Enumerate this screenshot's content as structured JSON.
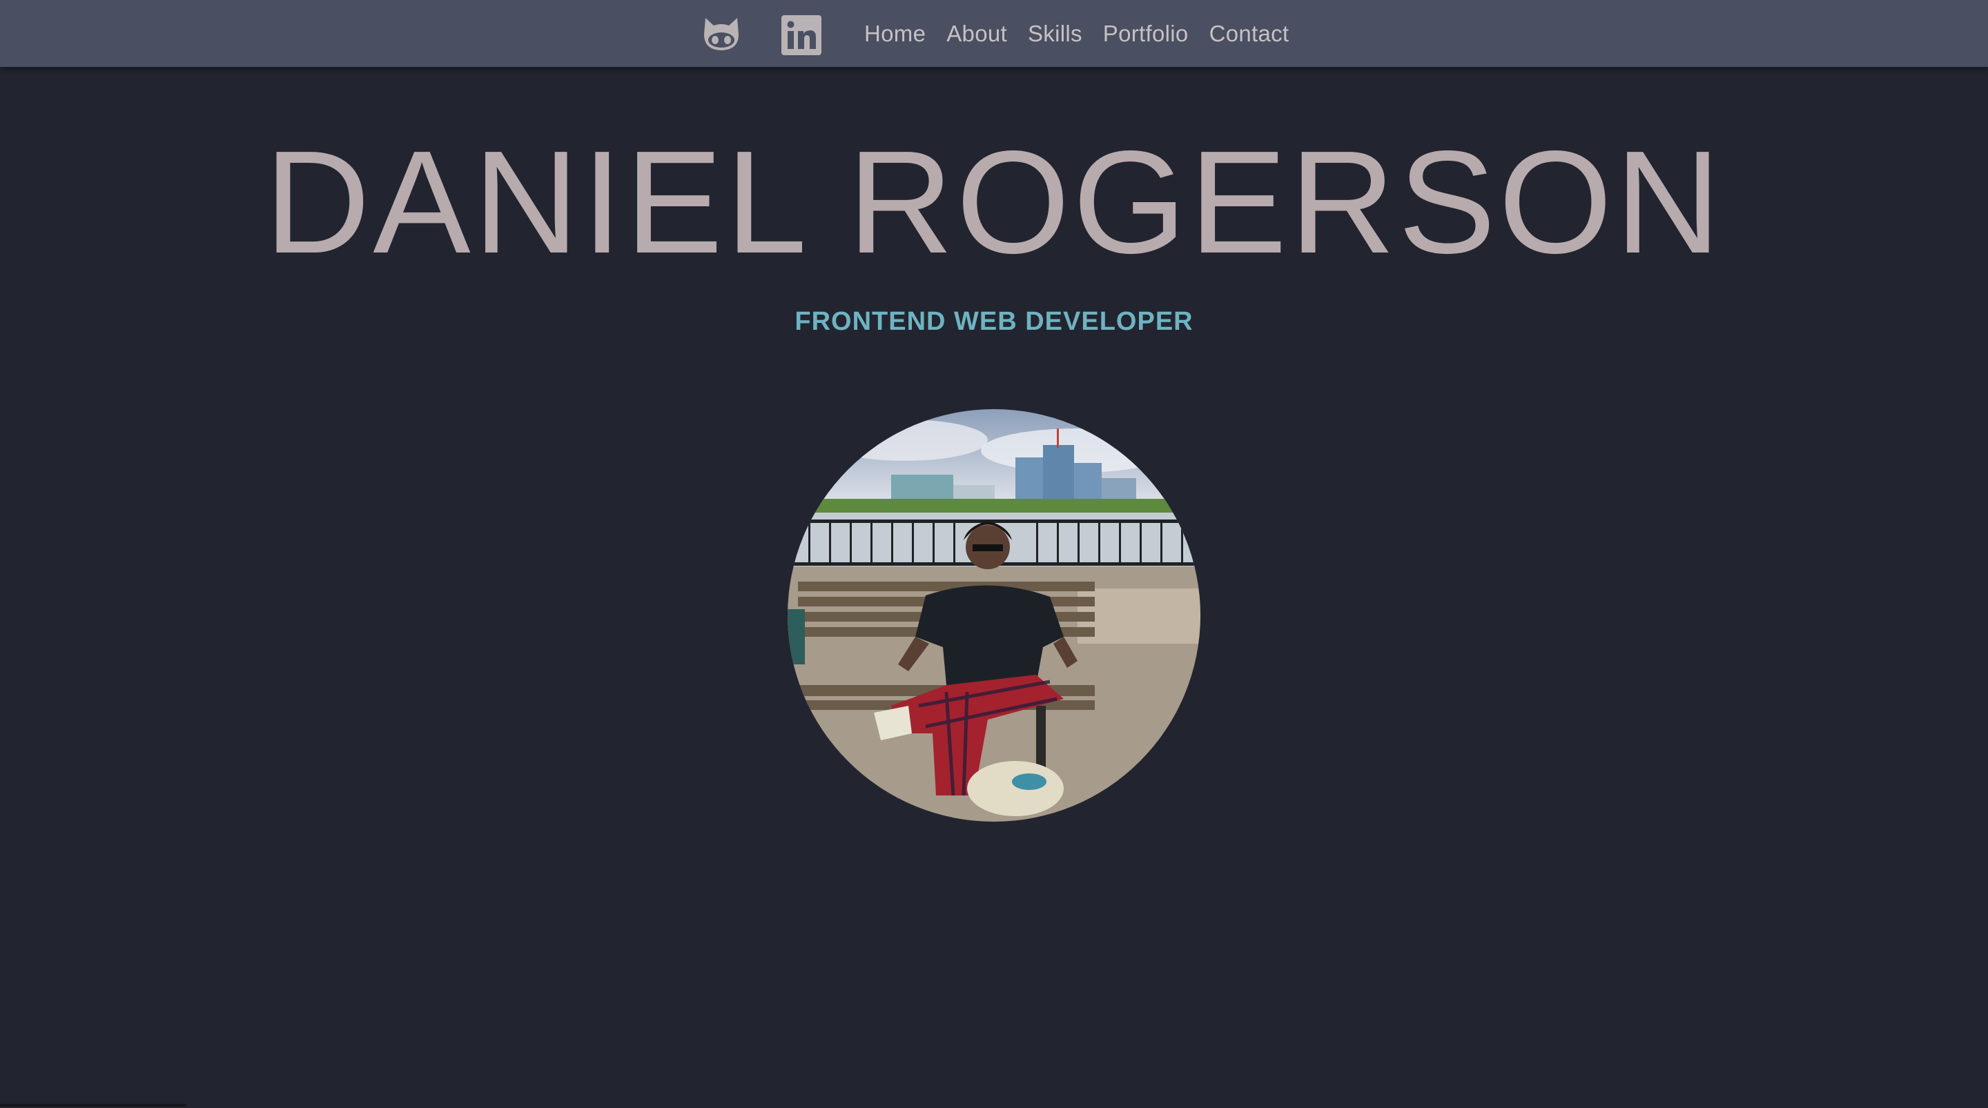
{
  "navbar": {
    "icons": [
      {
        "name": "github-icon",
        "glyph": "github-octocat"
      },
      {
        "name": "linkedin-icon",
        "glyph": "linkedin-in"
      }
    ],
    "links": [
      {
        "label": "Home"
      },
      {
        "label": "About"
      },
      {
        "label": "Skills"
      },
      {
        "label": "Portfolio"
      },
      {
        "label": "Contact"
      }
    ],
    "background": "#4a4f61",
    "link_color": "#c7c1c3"
  },
  "hero": {
    "name": "DANIEL ROGERSON",
    "subtitle": "FRONTEND WEB DEVELOPER",
    "name_color": "#b8abad",
    "subtitle_color": "#6fb3c2"
  },
  "page": {
    "background": "#22252f"
  }
}
